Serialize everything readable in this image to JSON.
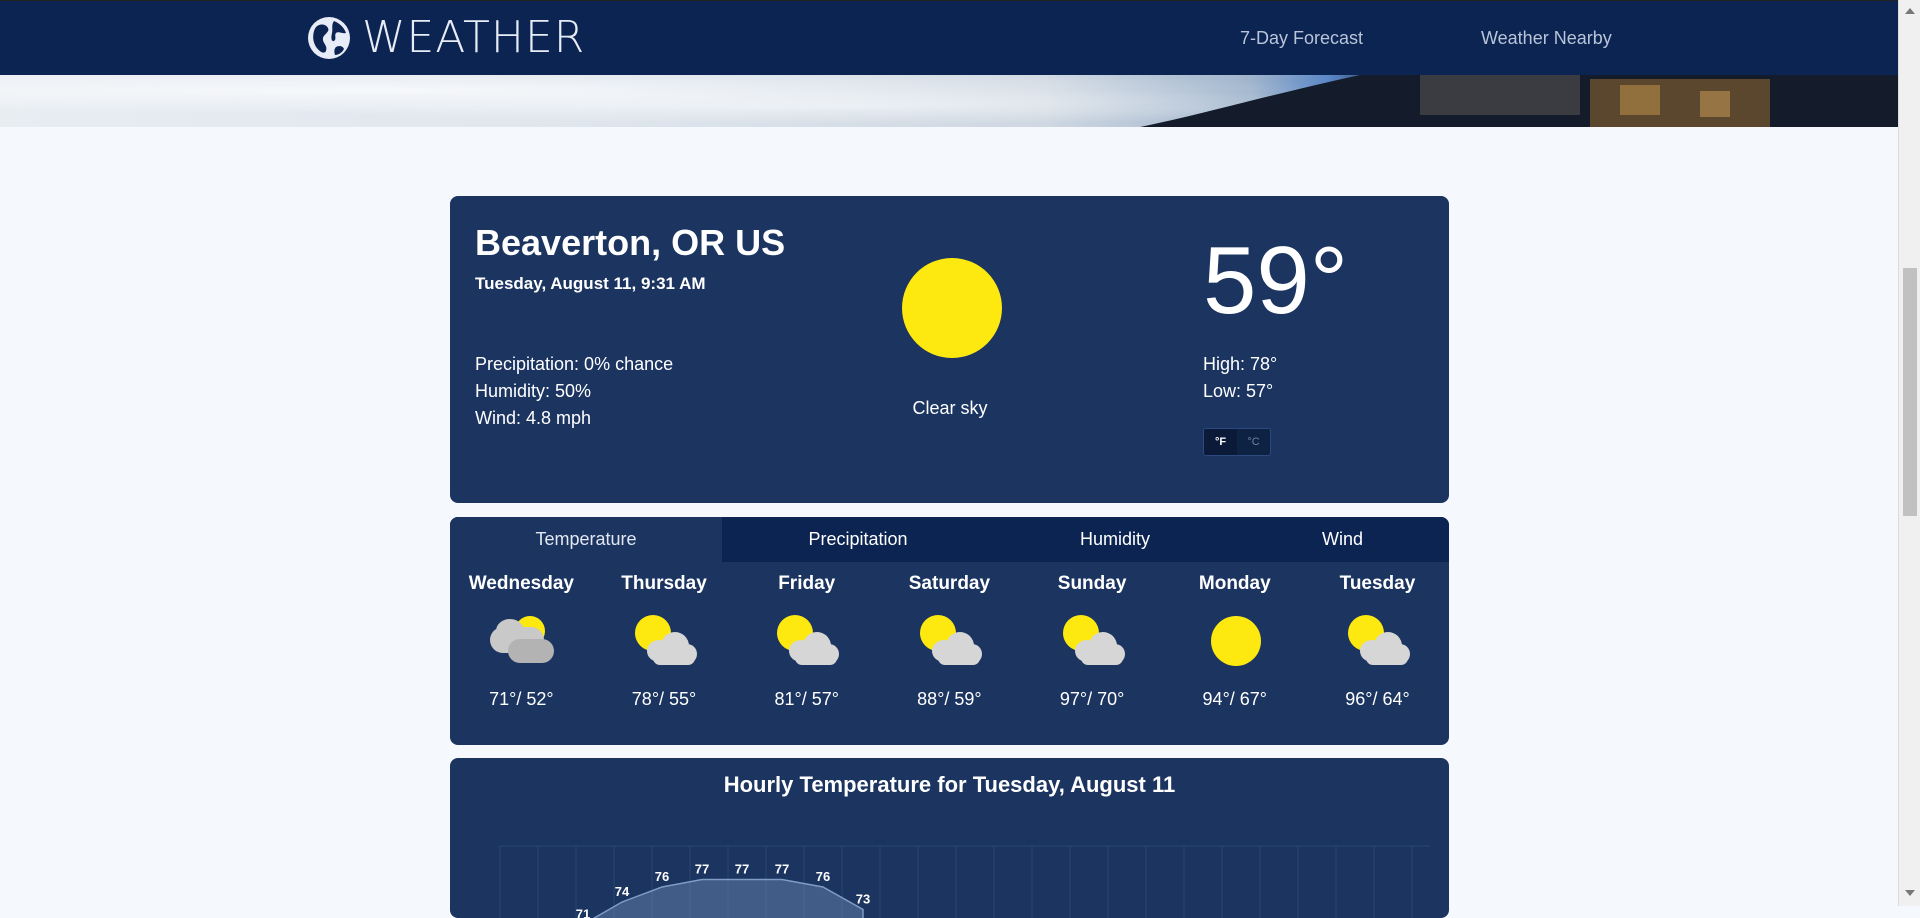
{
  "nav": {
    "logo_text": "WEATHER",
    "links": [
      "7-Day Forecast",
      "Weather Nearby"
    ]
  },
  "current": {
    "city": "Beaverton, OR US",
    "datetime": "Tuesday, August 11, 9:31 AM",
    "precipitation": "Precipitation: 0% chance",
    "humidity": "Humidity: 50%",
    "wind": "Wind: 4.8 mph",
    "condition": "Clear sky",
    "condition_icon": "sun-icon",
    "temperature": "59°",
    "high": "High: 78°",
    "low": "Low: 57°",
    "unit_f": "°F",
    "unit_c": "°C",
    "active_unit": "°F"
  },
  "forecast": {
    "tabs": [
      "Temperature",
      "Precipitation",
      "Humidity",
      "Wind"
    ],
    "active_tab": "Temperature",
    "days": [
      {
        "name": "Wednesday",
        "icon": "cloudy-icon",
        "temps": "71°/ 52°"
      },
      {
        "name": "Thursday",
        "icon": "partly-cloudy-icon",
        "temps": "78°/ 55°"
      },
      {
        "name": "Friday",
        "icon": "partly-cloudy-icon",
        "temps": "81°/ 57°"
      },
      {
        "name": "Saturday",
        "icon": "partly-cloudy-icon",
        "temps": "88°/ 59°"
      },
      {
        "name": "Sunday",
        "icon": "partly-cloudy-icon",
        "temps": "97°/ 70°"
      },
      {
        "name": "Monday",
        "icon": "sun-icon",
        "temps": "94°/ 67°"
      },
      {
        "name": "Tuesday",
        "icon": "partly-cloudy-icon",
        "temps": "96°/ 64°"
      }
    ]
  },
  "hourly": {
    "title": "Hourly Temperature for Tuesday, August 11"
  },
  "colors": {
    "nav_bg": "#0b2452",
    "card_bg": "#1b3460",
    "sun": "#fde910",
    "cloud": "#d6d6d6",
    "page_bg": "#f5f8fd"
  },
  "chart_data": {
    "type": "area",
    "title": "Hourly Temperature for Tuesday, August 11",
    "values": [
      71,
      74,
      76,
      77,
      77,
      77,
      76,
      73
    ],
    "data_labels": [
      "71",
      "74",
      "76",
      "77",
      "77",
      "77",
      "76",
      "73"
    ],
    "grid": true
  }
}
